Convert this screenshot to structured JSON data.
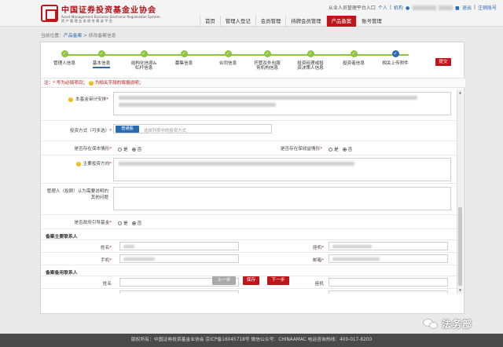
{
  "header": {
    "logo_title": "中国证券投资基金业协会",
    "logo_en": "Asset Management Business Electronic Registration System",
    "logo_cn_sub": "资 产 管 理 业 务 综 合 报 送 平 台",
    "entry_text": "从业人员管理平台入口",
    "personal": "个人",
    "org": "机构",
    "logout": "退出",
    "cancel_account": "注销账号"
  },
  "nav": {
    "items": [
      "首页",
      "管理人登记",
      "会员管理",
      "持牌会员管理",
      "产品备案",
      "账号管理"
    ],
    "active_index": 4
  },
  "breadcrumb": {
    "prefix": "当前位置：",
    "link": "产品备案",
    "sep": " > ",
    "current": "修改备案信息"
  },
  "steps": {
    "items": [
      "管理人信息",
      "基本信息",
      "结构化信息&\n杠杆信息",
      "募集信息",
      "合同信息",
      "托管及外包服\n务机构信息",
      "投资经理或投\n资决策人信息",
      "投资者信息",
      "相关上传附件"
    ],
    "current_tab_index": 1,
    "active_dot_index": 8
  },
  "submit_label": "提交",
  "notice": {
    "required": "注：* 号为必填项目；",
    "tip": "为相关字段的填报说明；"
  },
  "form": {
    "fund_audit_label": "本基金审计安排",
    "invest_method_label": "投资方式（可多选）",
    "pick_button": "普通股",
    "pick_placeholder": "选择列表中的投资方式",
    "guarantee_label": "是否存在保本情形",
    "guaranteed_return_label": "是否存在保收益情形",
    "main_invest_label": "主要投资方向",
    "other_issue_label": "管理人（投顾）认为需要说明的其他问题",
    "gov_guide_label": "是否政府引导基金",
    "yes": "是",
    "no": "否",
    "primary_contact_title": "备案主要联系人",
    "backup_contact_title": "备案备用联系人",
    "name_label": "姓名",
    "mobile_label": "手机",
    "landline_label": "座机",
    "email_label": "邮箱",
    "required_mark": "*"
  },
  "buttons": {
    "prev": "上一步",
    "save": "保存",
    "next": "下一步"
  },
  "footer": {
    "text": "版权所有：中国证券投资基金业协会    京ICP备16045718号    微信公众号：CHINAAMAC    电话咨询热线：400-017-8200"
  },
  "watermark": "法务部"
}
